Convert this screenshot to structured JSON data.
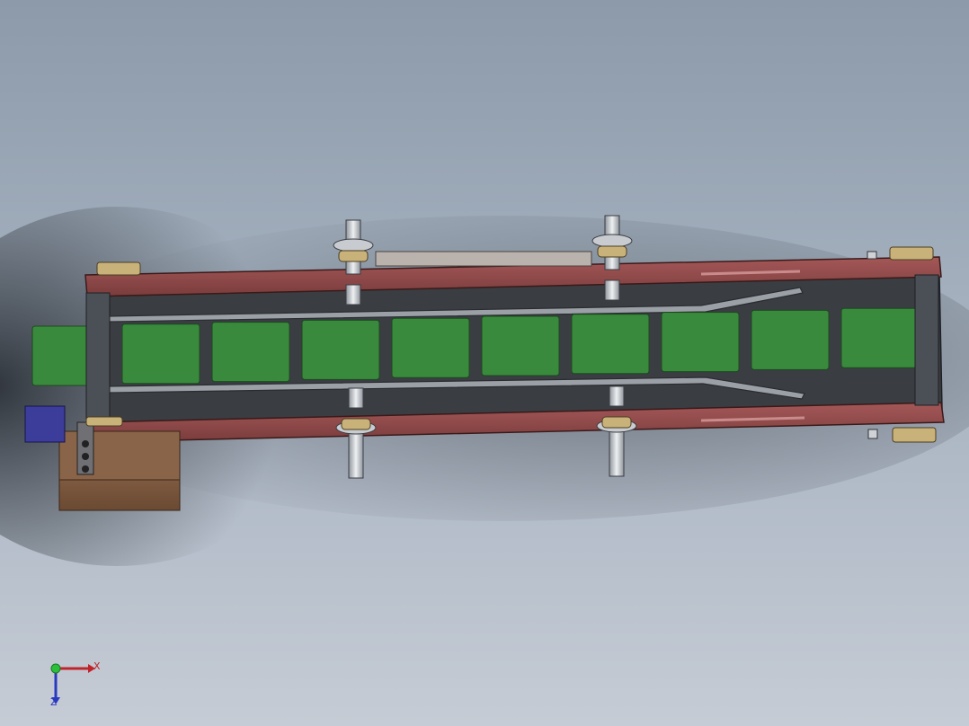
{
  "model": {
    "name": "",
    "colors": {
      "background_top": "#8c9aaa",
      "background_bottom": "#c6ccd5",
      "frame_rail": "#8b4a4a",
      "belt_bed": "#3a3d42",
      "belt_pad": "#3a8a3e",
      "roller_mount": "#c9b27a",
      "motor_body": "#8a6448",
      "bracket": "#3c3c9a",
      "shaft": "#cfd3d8"
    },
    "belt_pad_count": 10,
    "standoff_count": 4
  },
  "triad": {
    "x_label": "X",
    "z_label": "Z",
    "x_color": "#c0232a",
    "y_color": "#2bbf3a",
    "z_color": "#2a3ac0"
  }
}
